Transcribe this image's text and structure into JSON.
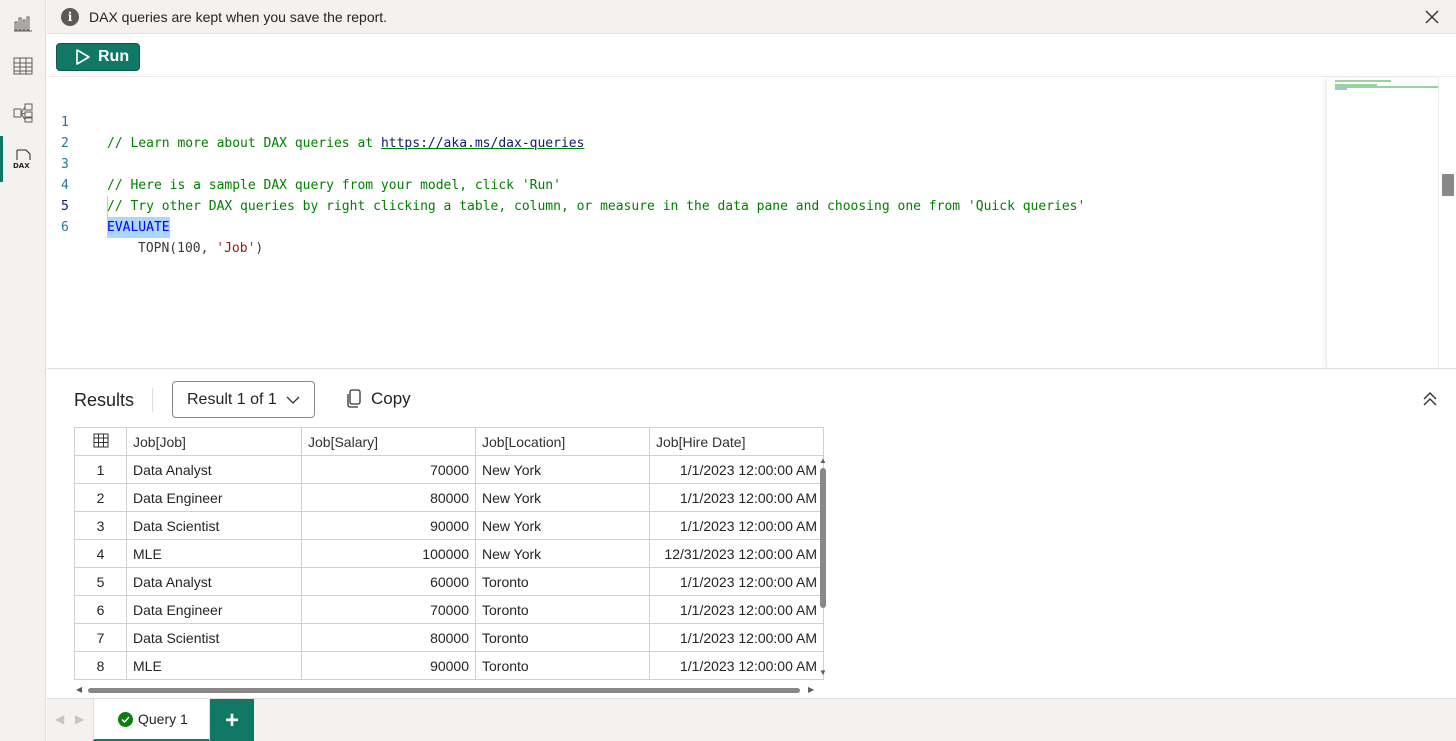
{
  "infobar": {
    "message": "DAX queries are kept when you save the report."
  },
  "toolbar": {
    "run_label": "Run"
  },
  "editor": {
    "lines": [
      {
        "num": "1",
        "comment_prefix": "// Learn more about DAX queries at ",
        "link": "https://aka.ms/dax-queries"
      },
      {
        "num": "2"
      },
      {
        "num": "3",
        "comment": "// Here is a sample DAX query from your model, click 'Run'"
      },
      {
        "num": "4",
        "comment": "// Try other DAX queries by right clicking a table, column, or measure in the data pane and choosing one from 'Quick queries'"
      },
      {
        "num": "5",
        "keyword": "EVALUATE"
      },
      {
        "num": "6",
        "fn": "TOPN(100, ",
        "str": "'Job'",
        "close": ")"
      }
    ]
  },
  "results": {
    "title": "Results",
    "selector": "Result 1 of 1",
    "copy_label": "Copy",
    "columns": [
      "Job[Job]",
      "Job[Salary]",
      "Job[Location]",
      "Job[Hire Date]"
    ],
    "rows": [
      [
        "1",
        "Data Analyst",
        "70000",
        "New York",
        "1/1/2023 12:00:00 AM"
      ],
      [
        "2",
        "Data Engineer",
        "80000",
        "New York",
        "1/1/2023 12:00:00 AM"
      ],
      [
        "3",
        "Data Scientist",
        "90000",
        "New York",
        "1/1/2023 12:00:00 AM"
      ],
      [
        "4",
        "MLE",
        "100000",
        "New York",
        "12/31/2023 12:00:00 AM"
      ],
      [
        "5",
        "Data Analyst",
        "60000",
        "Toronto",
        "1/1/2023 12:00:00 AM"
      ],
      [
        "6",
        "Data Engineer",
        "70000",
        "Toronto",
        "1/1/2023 12:00:00 AM"
      ],
      [
        "7",
        "Data Scientist",
        "80000",
        "Toronto",
        "1/1/2023 12:00:00 AM"
      ],
      [
        "8",
        "MLE",
        "90000",
        "Toronto",
        "1/1/2023 12:00:00 AM"
      ]
    ]
  },
  "tabs": {
    "query_tab": "Query 1",
    "add_label": "+"
  },
  "icons": {
    "rail": [
      "report-view-icon",
      "table-view-icon",
      "model-view-icon",
      "dax-query-view-icon"
    ],
    "rail_dax_text": "DAX"
  },
  "colors": {
    "accent": "#117865",
    "success": "#107c10"
  }
}
